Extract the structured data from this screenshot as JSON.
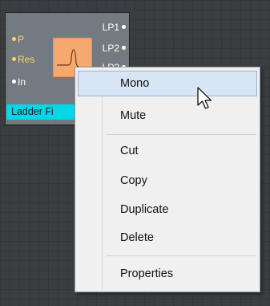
{
  "module": {
    "title": "Ladder Fi",
    "inputs": [
      {
        "label": "P"
      },
      {
        "label": "Res"
      },
      {
        "label": "In"
      }
    ],
    "outputs": [
      {
        "label": "LP1"
      },
      {
        "label": "LP2"
      },
      {
        "label": "LP3"
      }
    ],
    "icon": "lowpass-filter-icon",
    "colors": {
      "title_bar": "#00d8e8",
      "icon_bg": "#f6a96f",
      "input_port": "#ffd36a"
    }
  },
  "context_menu": {
    "items": [
      {
        "label": "Mono",
        "hovered": true
      },
      {
        "label": "Mute"
      },
      {
        "label": "Cut"
      },
      {
        "label": "Copy"
      },
      {
        "label": "Duplicate"
      },
      {
        "label": "Delete"
      },
      {
        "label": "Properties"
      }
    ],
    "hover_color": "#d7e5f5"
  },
  "cursor": {
    "icon": "arrow-cursor-icon"
  }
}
